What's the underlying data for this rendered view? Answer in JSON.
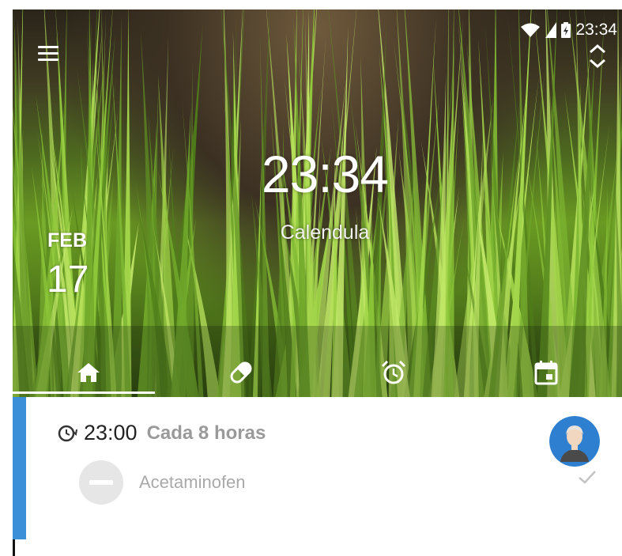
{
  "status_bar": {
    "time": "23:34"
  },
  "header": {
    "clock": "23:34",
    "app_name": "Calendula",
    "month": "FEB",
    "day": "17"
  },
  "tabs": [
    {
      "name": "home",
      "icon": "home-icon",
      "selected": true
    },
    {
      "name": "medicines",
      "icon": "pill-icon",
      "selected": false
    },
    {
      "name": "routines",
      "icon": "alarm-icon",
      "selected": false
    },
    {
      "name": "calendar",
      "icon": "calendar-icon",
      "selected": false
    }
  ],
  "schedule_item": {
    "time": "23:00",
    "frequency": "Cada 8 horas",
    "medicine": "Acetaminofen",
    "accent_color": "#3b8ed8",
    "avatar_color": "#2f7fd1"
  }
}
